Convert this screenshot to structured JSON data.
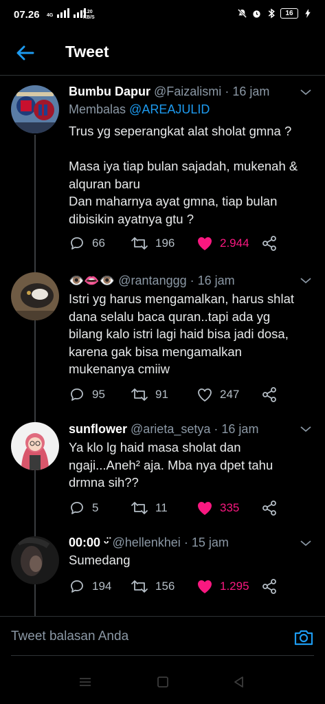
{
  "status_bar": {
    "time": "07.26",
    "network_type": "4G",
    "net_speed_value": "0.20",
    "net_speed_unit": "KB/S",
    "battery": "16"
  },
  "header": {
    "title": "Tweet"
  },
  "tweets": [
    {
      "name": "Bumbu Dapur",
      "handle": "@Faizalismi",
      "time": "16 jam",
      "reply_prefix": "Membalas",
      "reply_to": "@AREAJULID",
      "lines": [
        "Trus yg seperangkat alat sholat gmna ?",
        "",
        "Masa iya tiap bulan sajadah, mukenah &",
        "alquran baru",
        "Dan maharnya ayat gmna, tiap bulan",
        "dibisikin ayatnya gtu ?"
      ],
      "replies": "66",
      "retweets": "196",
      "likes": "2.944",
      "liked": true
    },
    {
      "name": "👁️👄👁️",
      "handle": "@rantanggg",
      "time": "16 jam",
      "lines": [
        "Istri yg harus mengamalkan, harus shlat",
        "dana selalu baca quran..tapi ada yg",
        "bilang kalo istri lagi haid bisa jadi dosa,",
        "karena gak bisa mengamalkan",
        "mukenanya cmiiw"
      ],
      "replies": "95",
      "retweets": "91",
      "likes": "247",
      "liked": false
    },
    {
      "name": "sunflower",
      "handle": "@arieta_setya",
      "time": "16 jam",
      "lines": [
        "Ya klo lg haid masa sholat dan",
        "ngaji...Aneh² aja. Mba nya dpet tahu",
        "drmna sih??"
      ],
      "replies": "5",
      "retweets": "11",
      "likes": "335",
      "liked": true
    },
    {
      "name": "00:00 ᵕ̈",
      "handle": "@hellenkhei",
      "time": "15 jam",
      "lines": [
        "Sumedang"
      ],
      "replies": "194",
      "retweets": "156",
      "likes": "1.295",
      "liked": true
    }
  ],
  "reply_bar": {
    "placeholder": "Tweet balasan Anda"
  },
  "colors": {
    "background": "#000000",
    "accent": "#1d9bf0",
    "like": "#f91880",
    "muted": "#8b98a5"
  },
  "icons": [
    "back-arrow-icon",
    "chevron-down-icon",
    "reply-icon",
    "retweet-icon",
    "heart-icon",
    "share-icon",
    "camera-icon"
  ]
}
